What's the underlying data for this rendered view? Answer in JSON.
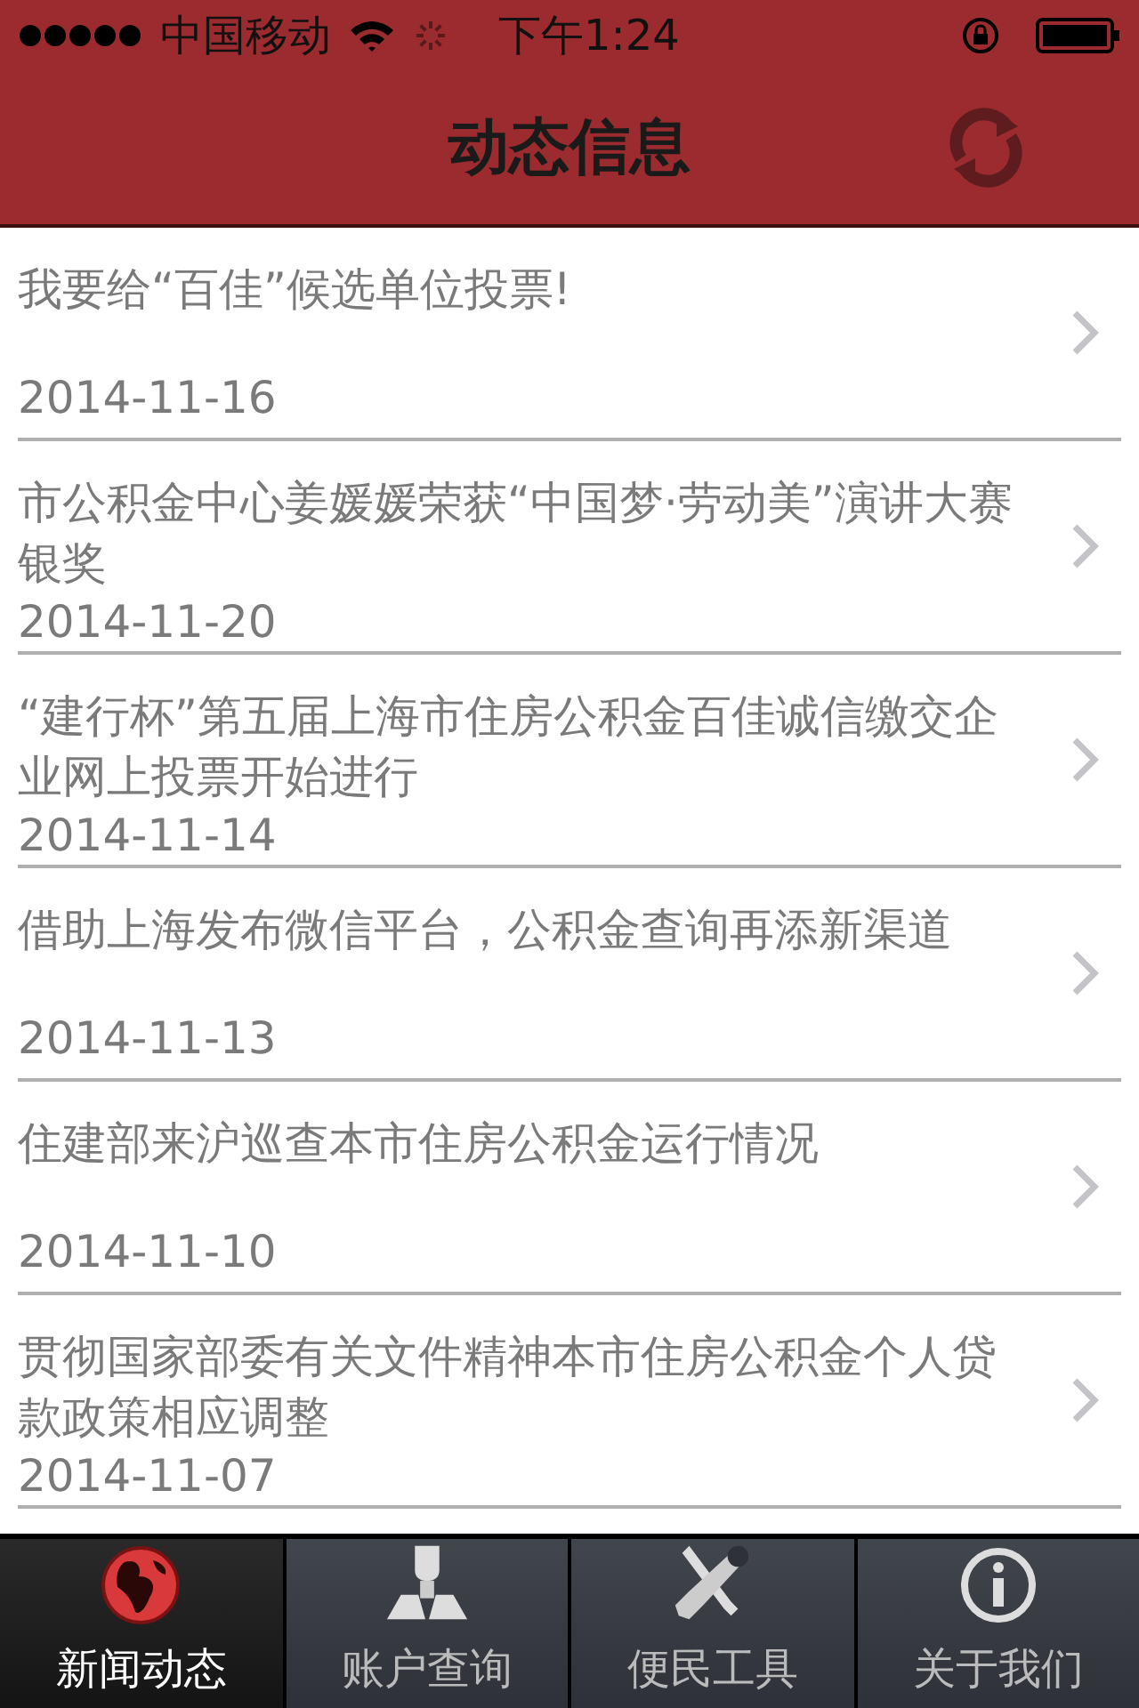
{
  "status_bar": {
    "carrier": "中国移动",
    "time": "下午1:24"
  },
  "header": {
    "title": "动态信息"
  },
  "news": [
    {
      "title": "我要给“百佳”候选单位投票!",
      "date": "2014-11-16"
    },
    {
      "title": "市公积金中心姜媛媛荣获“中国梦·劳动美”演讲大赛银奖",
      "date": "2014-11-20"
    },
    {
      "title": "“建行杯”第五届上海市住房公积金百佳诚信缴交企业网上投票开始进行",
      "date": "2014-11-14"
    },
    {
      "title": "借助上海发布微信平台，公积金查询再添新渠道",
      "date": "2014-11-13"
    },
    {
      "title": "住建部来沪巡查本市住房公积金运行情况",
      "date": "2014-11-10"
    },
    {
      "title": "贯彻国家部委有关文件精神本市住房公积金个人贷款政策相应调整",
      "date": "2014-11-07"
    }
  ],
  "tabs": [
    {
      "kind": "globe",
      "label": "新闻动态",
      "selected": true
    },
    {
      "kind": "person",
      "label": "账户查询",
      "selected": false
    },
    {
      "kind": "tools",
      "label": "便民工具",
      "selected": false
    },
    {
      "kind": "info",
      "label": "关于我们",
      "selected": false
    }
  ]
}
